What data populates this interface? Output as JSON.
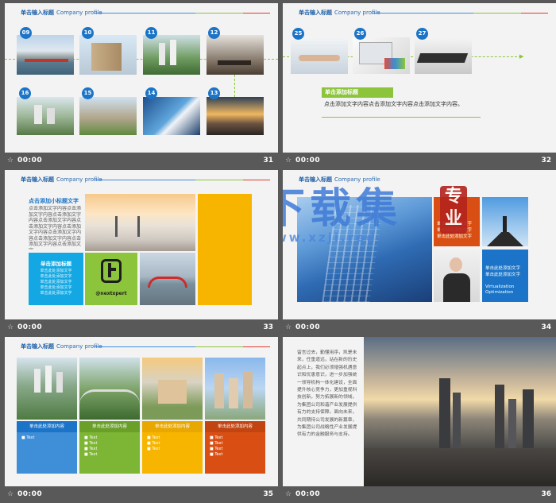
{
  "header": {
    "title": "单击输入标题",
    "subtitle": "Company profile"
  },
  "slides": [
    {
      "number": "31",
      "time": "00:00",
      "badges": [
        "09",
        "10",
        "11",
        "12",
        "16",
        "15",
        "14",
        "13"
      ]
    },
    {
      "number": "32",
      "time": "00:00",
      "badges": [
        "25",
        "26",
        "27"
      ],
      "tag": "单击添加标题",
      "text": "点击添加文字内容点击添加文字内容点击添加文字内容。"
    },
    {
      "number": "33",
      "time": "00:00",
      "heading": "点击添加小标题文字",
      "body": "点击添加文字内容点击添加文字内容点击添加文字内容点击添加文字内容点击添加文字内容点击添加文字内容点击添加文字内容点击添加文字内容点击添加文字内容点击添加文字",
      "box_title": "单击添加标题",
      "box_lines": [
        "单击此处添加文字",
        "单击此处添加文字",
        "单击此处添加文字",
        "单击此处添加文字",
        "单击此处添加文字"
      ],
      "logo_text": "@nextxpert"
    },
    {
      "number": "34",
      "time": "00:00",
      "red_lines": [
        "单击此处添加文字",
        "单击此处添加文字",
        "单击此处添加文字"
      ],
      "blue_lines": [
        "单击此处添加文字",
        "单击此处添加文字"
      ],
      "blue_en": [
        "Virtualization",
        "Optimization"
      ]
    },
    {
      "number": "35",
      "time": "00:00",
      "labels": [
        "单击此处添加内容",
        "单击此处添加内容",
        "单击此处添加内容",
        "单击此处添加内容"
      ],
      "bullet": "Text"
    },
    {
      "number": "36",
      "time": "00:00",
      "paragraph": "留言过去，勤懂用序，凯是未来，任重道远，站在新的历史起点上，我们必须增强机遇意识和忧患意识，进一步加强统一领导机构一体化建设，全面提升核心竞争力，更加重视科技创新，努力拓展新的领域，为集团公司和谐产业发展提供有力的支持保障。面向未来，共同期待公司发展的新篇章，为集团公司战略性产业发展提供有力的金融服务与支持。"
    }
  ],
  "watermark": {
    "big": "下载集",
    "seal": "专业",
    "url": "www.xzji.red"
  },
  "colors": {
    "blue": "#1b74c7",
    "green": "#8cc43c",
    "yellow": "#f7b500",
    "orange": "#d94f13",
    "cyan": "#13a8e3"
  }
}
